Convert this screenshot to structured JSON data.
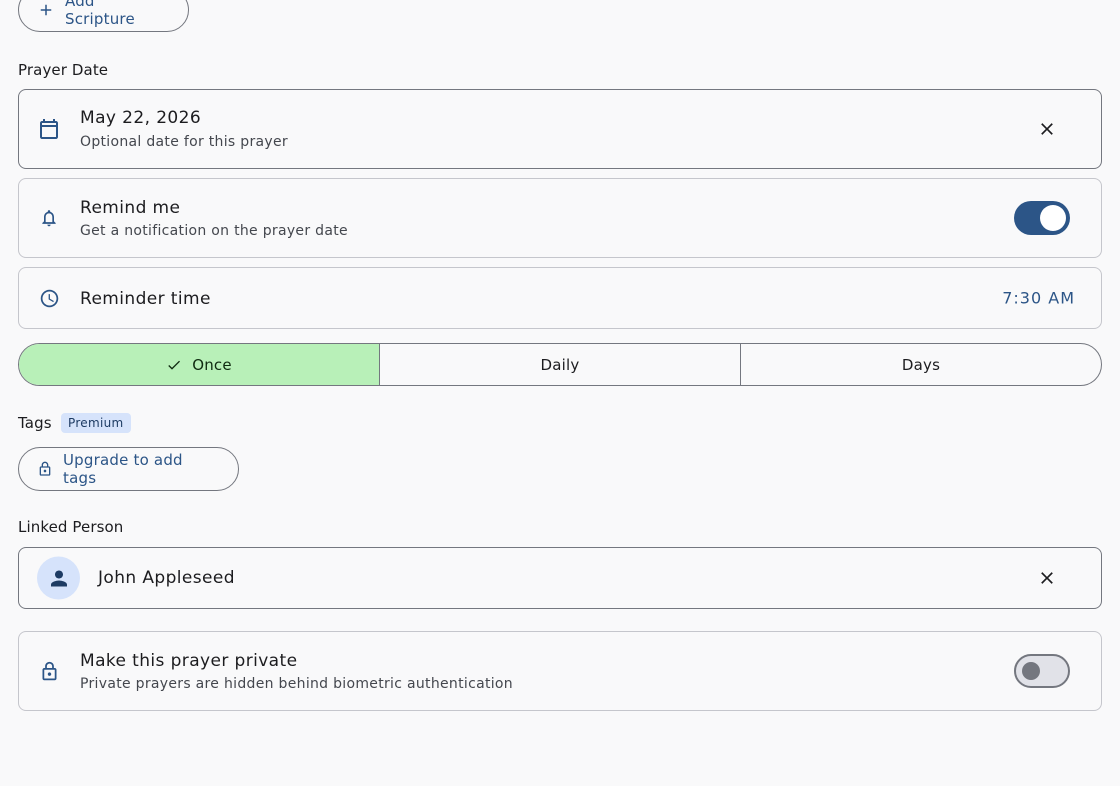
{
  "scripture": {
    "add_label": "Add Scripture"
  },
  "prayer_date": {
    "section_label": "Prayer Date",
    "value": "May 22, 2026",
    "helper": "Optional date for this prayer"
  },
  "remind": {
    "title": "Remind me",
    "subtitle": "Get a notification on the prayer date",
    "enabled": true
  },
  "reminder_time": {
    "label": "Reminder time",
    "value": "7:30 AM"
  },
  "repeat": {
    "options": [
      "Once",
      "Daily",
      "Days"
    ],
    "selected": "Once"
  },
  "tags": {
    "section_label": "Tags",
    "badge": "Premium",
    "upgrade_label": "Upgrade to add tags"
  },
  "linked_person": {
    "section_label": "Linked Person",
    "name": "John Appleseed"
  },
  "privacy": {
    "title": "Make this prayer private",
    "subtitle": "Private prayers are hidden behind biometric authentication",
    "enabled": false
  },
  "colors": {
    "primary": "#2c5587",
    "selected_segment": "#b8f0b8",
    "badge_bg": "#d6e3fb"
  }
}
